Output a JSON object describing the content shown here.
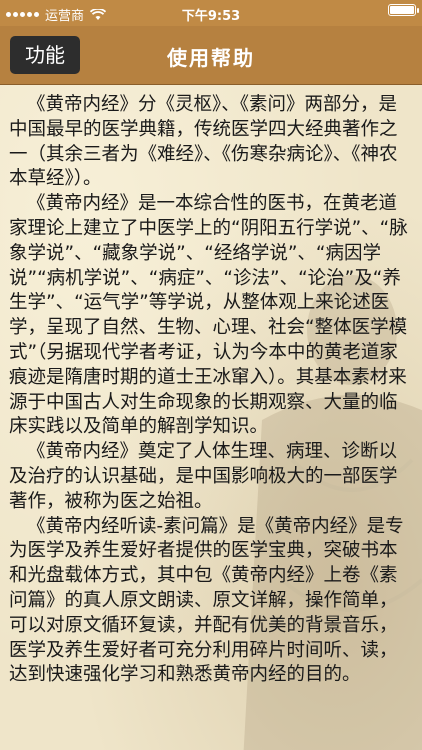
{
  "status_bar": {
    "carrier": "运营商",
    "time": "下午9:53"
  },
  "nav": {
    "back_label": "功能",
    "title": "使用帮助"
  },
  "content": {
    "paragraphs": [
      "《黄帝内经》分《灵枢》、《素问》两部分，是中国最早的医学典籍，传统医学四大经典著作之一（其余三者为《难经》、《伤寒杂病论》、《神农本草经》）。",
      "《黄帝内经》是一本综合性的医书，在黄老道家理论上建立了中医学上的“阴阳五行学说”、“脉象学说”、“藏象学说”、“经络学说”、“病因学说”“病机学说”、“病症”、“诊法”、“论治”及“养生学”、“运气学”等学说，从整体观上来论述医学，呈现了自然、生物、心理、社会“整体医学模式”（另据现代学者考证，认为今本中的黄老道家痕迹是隋唐时期的道士王冰窜入）。其基本素材来源于中国古人对生命现象的长期观察、大量的临床实践以及简单的解剖学知识。",
      "《黄帝内经》奠定了人体生理、病理、诊断以及治疗的认识基础，是中国影响极大的一部医学著作，被称为医之始祖。",
      "《黄帝内经听读-素问篇》是《黄帝内经》是专为医学及养生爱好者提供的医学宝典，突破书本和光盘载体方式，其中包《黄帝内经》上卷《素问篇》的真人原文朗读、原文详解，操作简单，可以对原文循环复读，并配有优美的背景音乐，医学及养生爱好者可充分利用碎片时间听、读，达到快速强化学习和熟悉黄帝内经的目的。"
    ]
  },
  "icons": {
    "signal": "signal-dots-icon",
    "wifi": "wifi-icon",
    "battery": "battery-icon"
  },
  "colors": {
    "status_bar": "#c08a45",
    "nav_bar": "#b68140",
    "back_button": "#2d2d2d",
    "page_background": "#efe5c9"
  }
}
